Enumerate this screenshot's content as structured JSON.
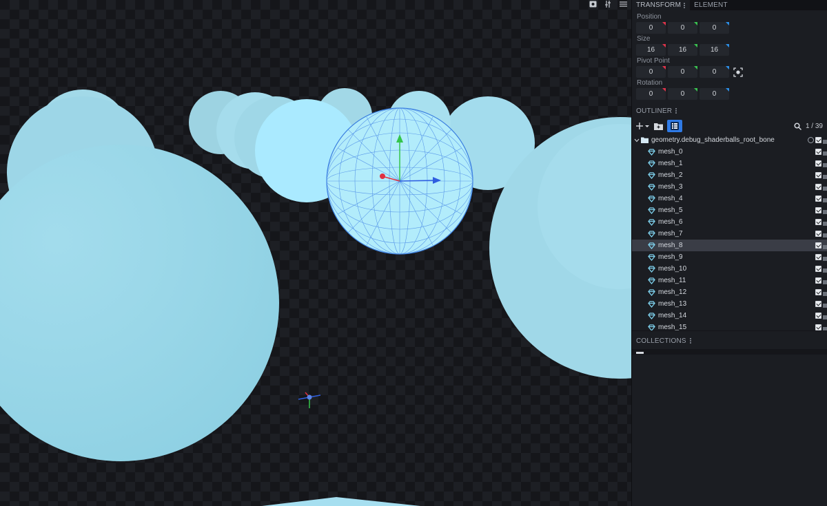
{
  "viewport": {
    "tools": [
      {
        "name": "camera-icon"
      },
      {
        "name": "sliders-icon"
      },
      {
        "name": "menu-icon"
      }
    ],
    "colors": {
      "sphere": "#a6e4f6",
      "sphere_shade": "#93d3e6",
      "wire": "#3b7fe0",
      "axis_x": "#e03040",
      "axis_y": "#34c44a",
      "axis_z": "#2f5ee0"
    }
  },
  "panel": {
    "tabs": [
      {
        "label": "TRANSFORM",
        "active": true
      },
      {
        "label": "ELEMENT",
        "active": false
      }
    ],
    "transform": {
      "position": {
        "label": "Position",
        "x": "0",
        "y": "0",
        "z": "0"
      },
      "size": {
        "label": "Size",
        "x": "16",
        "y": "16",
        "z": "16"
      },
      "pivot": {
        "label": "Pivot Point",
        "x": "0",
        "y": "0",
        "z": "0"
      },
      "rotation": {
        "label": "Rotation",
        "x": "0",
        "y": "0",
        "z": "0"
      }
    },
    "outliner": {
      "title": "OUTLINER",
      "count": "1 / 39",
      "root": "geometry.debug_shaderballs_root_bone",
      "items": [
        "mesh_0",
        "mesh_1",
        "mesh_2",
        "mesh_3",
        "mesh_4",
        "mesh_5",
        "mesh_6",
        "mesh_7",
        "mesh_8",
        "mesh_9",
        "mesh_10",
        "mesh_11",
        "mesh_12",
        "mesh_13",
        "mesh_14",
        "mesh_15"
      ],
      "selected_index": 8
    },
    "collections": {
      "title": "COLLECTIONS"
    }
  }
}
